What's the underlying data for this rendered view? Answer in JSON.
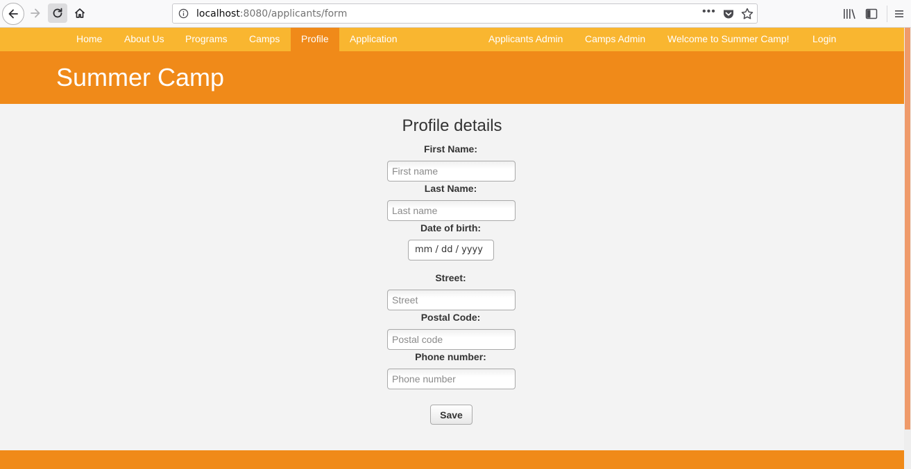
{
  "browser": {
    "url_host": "localhost",
    "url_path": ":8080/applicants/form"
  },
  "nav": {
    "left": [
      "Home",
      "About Us",
      "Programs",
      "Camps",
      "Profile",
      "Application"
    ],
    "right": [
      "Applicants Admin",
      "Camps Admin",
      "Welcome to Summer Camp!",
      "Login"
    ],
    "active": "Profile"
  },
  "header": {
    "title": "Summer Camp"
  },
  "form": {
    "title": "Profile details",
    "first_name": {
      "label": "First Name:",
      "placeholder": "First name"
    },
    "last_name": {
      "label": "Last Name:",
      "placeholder": "Last name"
    },
    "dob": {
      "label": "Date of birth:",
      "value": "mm / dd / yyyy"
    },
    "street": {
      "label": "Street:",
      "placeholder": "Street"
    },
    "postal_code": {
      "label": "Postal Code:",
      "placeholder": "Postal code"
    },
    "phone": {
      "label": "Phone number:",
      "placeholder": "Phone number"
    },
    "save_label": "Save"
  },
  "colors": {
    "navbar": "#f9b630",
    "header": "#f08a19",
    "active_tab": "#f08a19"
  }
}
